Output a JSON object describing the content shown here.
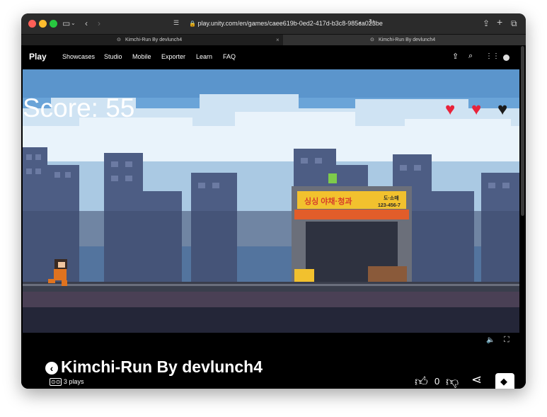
{
  "browser": {
    "url": "play.unity.com/en/games/caee619b-0ed2-417d-b3c8-985ca023be",
    "tabs": [
      {
        "label": "Kimchi-Run By devlunch4"
      },
      {
        "label": "Kimchi-Run By devlunch4"
      }
    ]
  },
  "site": {
    "logo": "Play",
    "nav": [
      "Showcases",
      "Studio",
      "Mobile",
      "Exporter",
      "Learn",
      "FAQ"
    ]
  },
  "game": {
    "score_label": "Score: 55",
    "lives": {
      "filled": 2,
      "total": 3
    },
    "shop_sign_left": "싱싱 야채·청과",
    "shop_sign_right_top": "도·소매",
    "shop_sign_right_bottom": "123-456-7"
  },
  "page": {
    "title": "Kimchi-Run By devlunch4",
    "plays": "3 plays",
    "likes": "0"
  },
  "colors": {
    "accent": "#e8233a",
    "sky": "#6aa4d8"
  }
}
